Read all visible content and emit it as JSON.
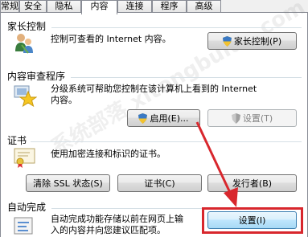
{
  "tabs": [
    {
      "label": "常规",
      "active": false
    },
    {
      "label": "安全",
      "active": false
    },
    {
      "label": "隐私",
      "active": false
    },
    {
      "label": "内容",
      "active": true
    },
    {
      "label": "连接",
      "active": false
    },
    {
      "label": "程序",
      "active": false
    },
    {
      "label": "高级",
      "active": false
    }
  ],
  "parental": {
    "title": "家长控制",
    "desc": "控制可查看的 Internet 内容。",
    "button": "家长控制(P)"
  },
  "advisor": {
    "title": "内容审查程序",
    "desc_line1": "分级系统可帮助您控制在该计算机上看到的 Internet",
    "desc_line2": "内容。",
    "enable_button": "启用(E)...",
    "settings_button": "设置(T)"
  },
  "certificates": {
    "title": "证书",
    "desc": "使用加密连接和标识的证书。",
    "clear_ssl_button": "清除 SSL 状态(S)",
    "certificates_button": "证书(C)",
    "publishers_button": "发行者(B)"
  },
  "autocomplete": {
    "title": "自动完成",
    "desc_line1": "自动完成功能存储以前在网页上输",
    "desc_line2": "入的内容并向您建议匹配项。",
    "settings_button": "设置(I)"
  },
  "colors": {
    "highlight": "#d8272d",
    "button_focus": "#3c7fb1"
  }
}
